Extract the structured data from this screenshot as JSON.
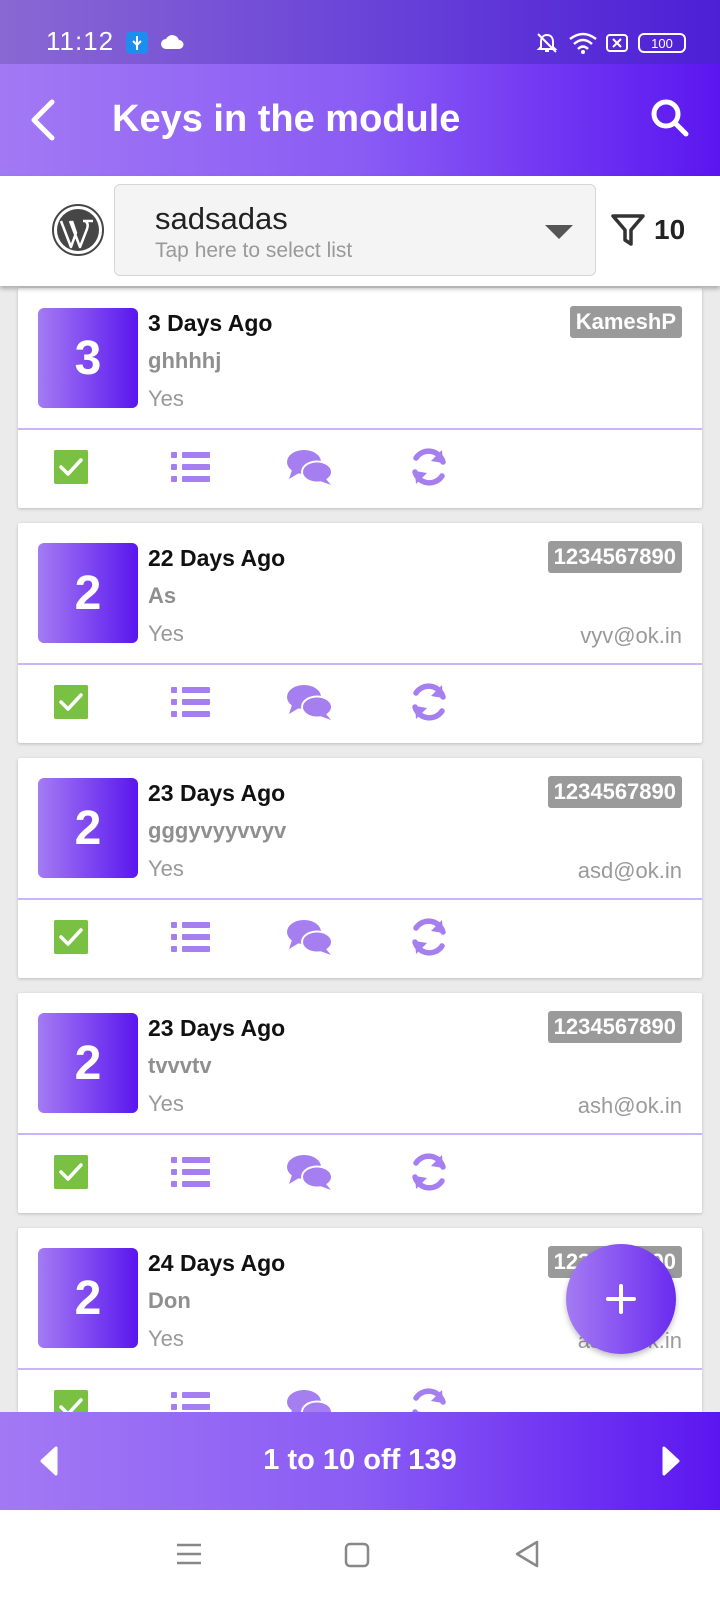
{
  "status_bar": {
    "time": "11:12",
    "battery": "100"
  },
  "app_bar": {
    "title": "Keys in the module"
  },
  "selector": {
    "list_name": "sadsadas",
    "hint": "Tap here to select list",
    "filter_count": "10"
  },
  "colors": {
    "primary": "#8a5cf4",
    "primary_dark": "#5b16f0",
    "check_green": "#7ac143",
    "tag_gray": "#9a9a9a"
  },
  "cards": [
    {
      "count": "3",
      "when": "3 Days Ago",
      "name": "ghhhhj",
      "flag": "Yes",
      "tag": "KameshP",
      "email": ""
    },
    {
      "count": "2",
      "when": "22 Days Ago",
      "name": "As",
      "flag": "Yes",
      "tag": "1234567890",
      "email": "vyv@ok.in"
    },
    {
      "count": "2",
      "when": "23 Days Ago",
      "name": "gggyvyyvvyv",
      "flag": "Yes",
      "tag": "1234567890",
      "email": "asd@ok.in"
    },
    {
      "count": "2",
      "when": "23 Days Ago",
      "name": "tvvvtv",
      "flag": "Yes",
      "tag": "1234567890",
      "email": "ash@ok.in"
    },
    {
      "count": "2",
      "when": "24 Days Ago",
      "name": "Don",
      "flag": "Yes",
      "tag": "1234567890",
      "email": "ash@ok.in"
    }
  ],
  "pager": {
    "text": "1 to 10 off 139"
  }
}
